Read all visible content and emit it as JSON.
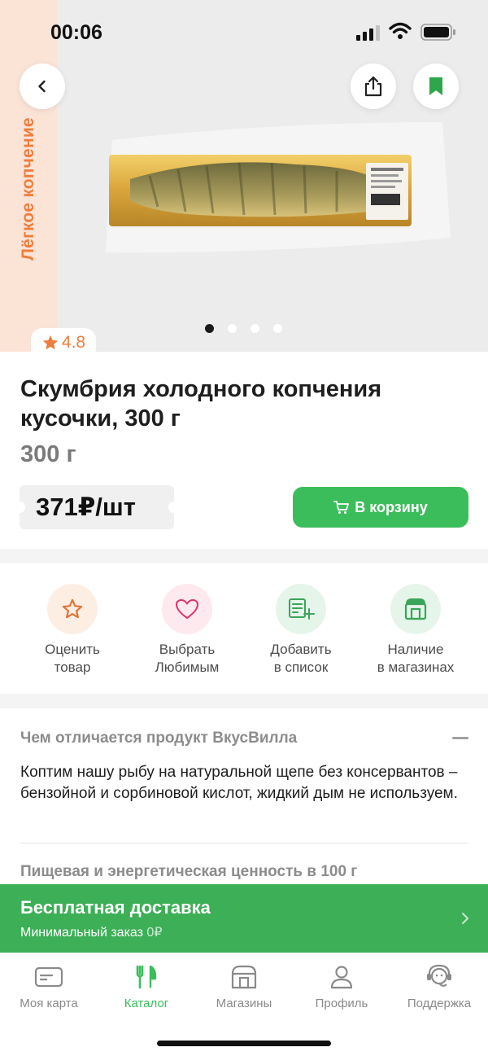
{
  "status_bar": {
    "time": "00:06"
  },
  "hero": {
    "side_label": "Лёгкое копчение",
    "rating": "4.8",
    "image_name": "smoked-mackerel-pack",
    "slides_total": 4,
    "slide_active": 1
  },
  "product": {
    "title": "Скумбрия холодного копчения кусочки, 300 г",
    "weight": "300 г",
    "price": "371₽/шт",
    "cart_label": "В корзину"
  },
  "actions": [
    {
      "line1": "Оценить",
      "line2": "товар",
      "icon": "star-icon"
    },
    {
      "line1": "Выбрать",
      "line2": "Любимым",
      "icon": "heart-icon"
    },
    {
      "line1": "Добавить",
      "line2": "в список",
      "icon": "add-to-list-icon"
    },
    {
      "line1": "Наличие",
      "line2": "в магазинах",
      "icon": "store-icon"
    }
  ],
  "description": {
    "heading": "Чем отличается продукт ВкусВилла",
    "text": "Коптим нашу рыбу на натуральной щепе без консервантов – бензойной и сорбиновой кислот, жидкий дым не используем.",
    "nutrition_heading": "Пищевая и энергетическая ценность в 100 г"
  },
  "delivery": {
    "title": "Бесплатная доставка",
    "subtitle": "Минимальный заказ",
    "min_order": "0₽"
  },
  "tabbar": [
    {
      "label": "Моя карта",
      "icon": "card-icon"
    },
    {
      "label": "Каталог",
      "icon": "catalog-icon"
    },
    {
      "label": "Магазины",
      "icon": "shops-icon"
    },
    {
      "label": "Профиль",
      "icon": "profile-icon"
    },
    {
      "label": "Поддержка",
      "icon": "support-icon"
    }
  ],
  "colors": {
    "accent_green": "#3cbd5c",
    "banner_green": "#3daf57",
    "orange": "#ef7d3c",
    "strip_peach": "#fbe3d6"
  }
}
